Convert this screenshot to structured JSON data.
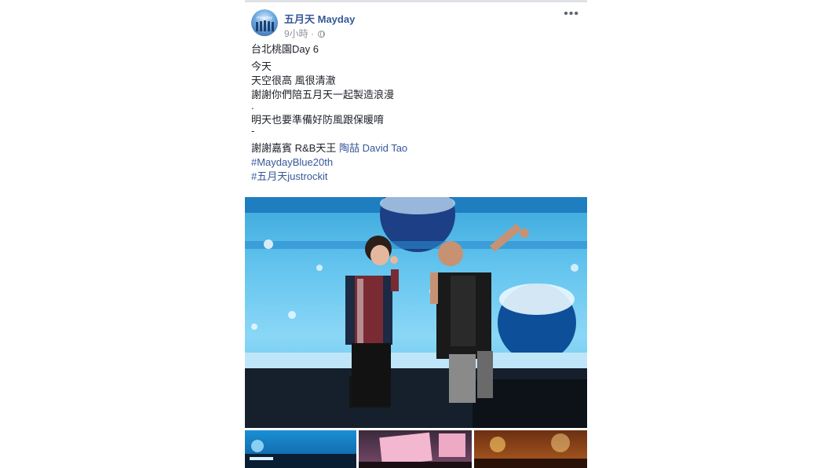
{
  "post": {
    "page_name": "五月天 Mayday",
    "time": "9小時",
    "meta_separator": "·",
    "more_label": "•••",
    "lines": {
      "l1": "台北桃園Day 6",
      "l2": "今天",
      "l3": "天空很高 風很清澈",
      "l4": "謝謝你們陪五月天一起製造浪漫",
      "l5": ".",
      "l6": "明天也要準備好防風跟保暖唷",
      "l7": "-",
      "l8_prefix": "謝謝嘉賓 R&B天王 ",
      "l8_link": "陶喆 David Tao",
      "l9": "#MaydayBlue20th",
      "l10": "#五月天justrockit"
    }
  },
  "colors": {
    "link": "#365899",
    "meta": "#90949c",
    "text": "#1d2129"
  },
  "icons": [
    "avatar",
    "globe-icon",
    "more-icon"
  ]
}
